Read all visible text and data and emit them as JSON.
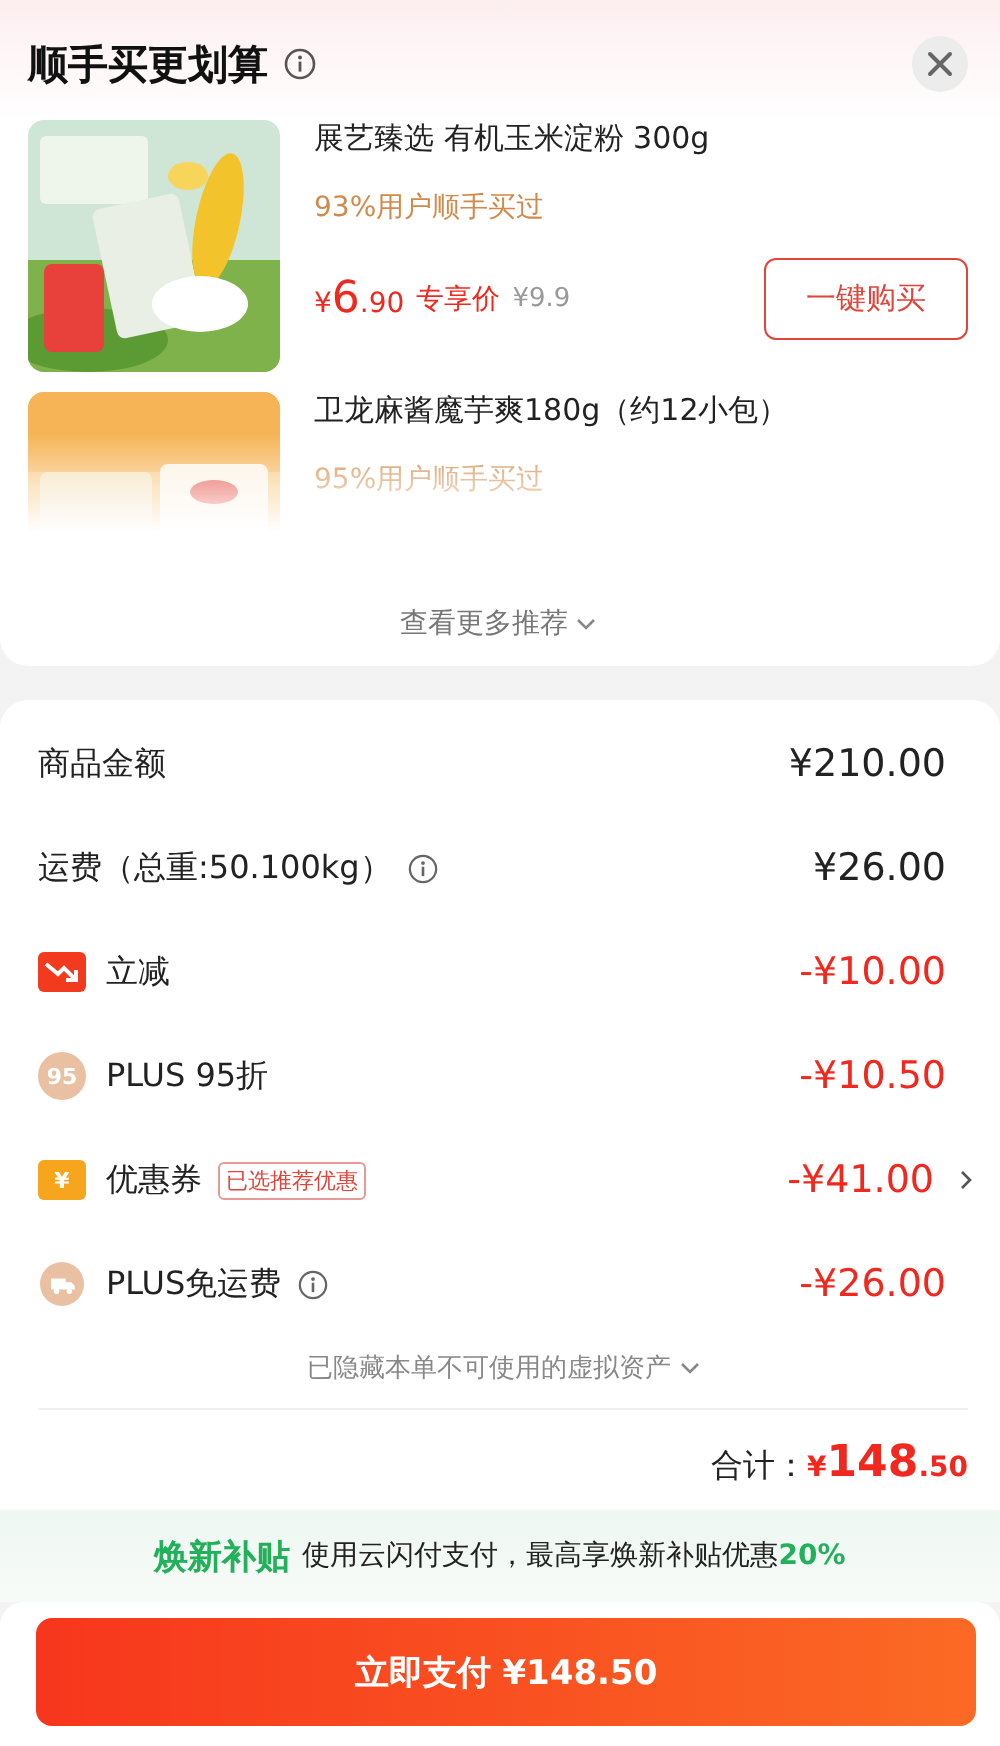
{
  "recommend": {
    "title": "顺手买更划算",
    "products": [
      {
        "name": "展艺臻选 有机玉米淀粉 300g",
        "buy_rate": "93%用户顺手买过",
        "faded": false,
        "price": {
          "symbol": "¥",
          "int": "6",
          "dec": ".90"
        },
        "price_label": "专享价",
        "original_price": "¥9.9",
        "button": "一键购买"
      },
      {
        "name": "卫龙麻酱魔芋爽180g（约12小包）",
        "buy_rate": "95%用户顺手买过",
        "faded": true
      }
    ],
    "more": "查看更多推荐"
  },
  "summary": {
    "rows": [
      {
        "kind": "plain",
        "label": "商品金额",
        "value": "¥210.00",
        "info": false,
        "chevron": false
      },
      {
        "kind": "plain",
        "label": "运费（总重:50.100kg）",
        "value": "¥26.00",
        "info": true,
        "chevron": false
      },
      {
        "kind": "instant",
        "label": "立减",
        "value": "-¥10.00",
        "info": false,
        "chevron": false
      },
      {
        "kind": "plus",
        "badge": "95",
        "label": "PLUS 95折",
        "value": "-¥10.50",
        "info": false,
        "chevron": false
      },
      {
        "kind": "coupon",
        "badge": "¥",
        "label": "优惠券",
        "tag": "已选推荐优惠",
        "value": "-¥41.00",
        "info": false,
        "chevron": true
      },
      {
        "kind": "shipping",
        "label": "PLUS免运费",
        "value": "-¥26.00",
        "info": true,
        "chevron": false
      }
    ],
    "hidden_note": "已隐藏本单不可使用的虚拟资产",
    "total": {
      "label": "合计：",
      "symbol": "¥",
      "int": "148",
      "dec": ".50"
    }
  },
  "banner": {
    "title": "焕新补贴",
    "text": "使用云闪付支付，最高享焕新补贴优惠**20%**"
  },
  "pay_button": "立即支付 ¥148.50"
}
